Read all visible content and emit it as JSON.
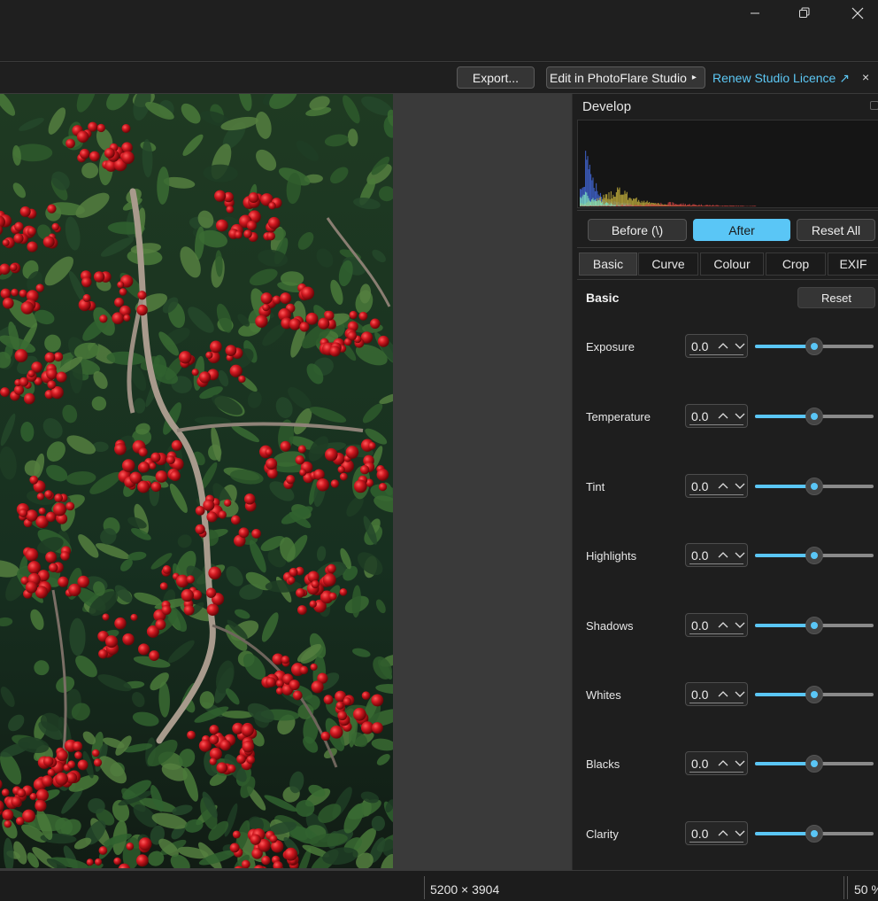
{
  "window": {
    "minimize_icon": "minimize-icon",
    "maximize_icon": "restore-icon",
    "close_icon": "close-icon"
  },
  "toolbar": {
    "export_label": "Export...",
    "edit_studio_label": "Edit in PhotoFlare Studio",
    "edit_studio_arrow": "▸",
    "renew_label": "Renew Studio Licence ↗",
    "renew_close": "×"
  },
  "panel": {
    "title": "Develop",
    "buttons": {
      "before": "Before  (\\)",
      "after": "After",
      "reset_all": "Reset All"
    },
    "tabs": [
      "Basic",
      "Curve",
      "Colour",
      "Crop",
      "EXIF"
    ],
    "active_tab": "Basic",
    "section_title": "Basic",
    "section_reset": "Reset",
    "adjustments": [
      {
        "label": "Exposure",
        "value": "0.0",
        "position": 0.5
      },
      {
        "label": "Temperature",
        "value": "0.0",
        "position": 0.5
      },
      {
        "label": "Tint",
        "value": "0.0",
        "position": 0.5
      },
      {
        "label": "Highlights",
        "value": "0.0",
        "position": 0.5
      },
      {
        "label": "Shadows",
        "value": "0.0",
        "position": 0.5
      },
      {
        "label": "Whites",
        "value": "0.0",
        "position": 0.5
      },
      {
        "label": "Blacks",
        "value": "0.0",
        "position": 0.5
      },
      {
        "label": "Clarity",
        "value": "0.0",
        "position": 0.5
      }
    ]
  },
  "status": {
    "dimensions": "5200 × 3904",
    "zoom": "50 %"
  },
  "colors": {
    "accent": "#5ac6f6",
    "background": "#1c1c1c"
  }
}
